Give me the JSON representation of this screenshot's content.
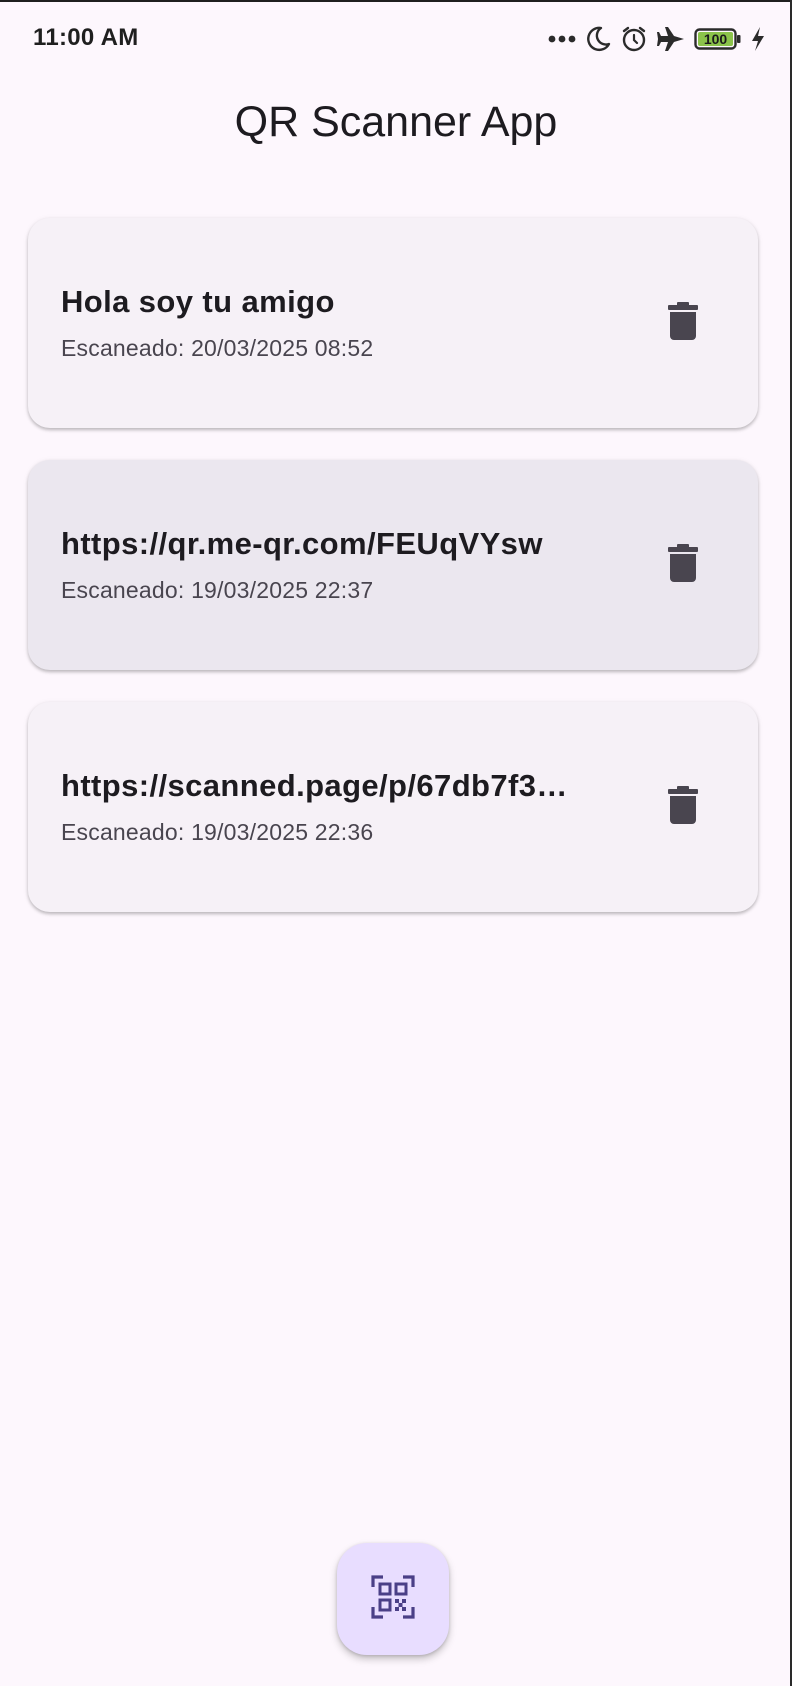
{
  "status_bar": {
    "time": "11:00 AM",
    "battery_level": "100",
    "icons": [
      "more-dots-icon",
      "moon-icon",
      "alarm-icon",
      "airplane-icon",
      "battery-icon",
      "charging-bolt-icon"
    ]
  },
  "app_bar": {
    "title": "QR Scanner App"
  },
  "scans": [
    {
      "value": "Hola soy tu amigo",
      "scanned_label": "Escaneado: 20/03/2025 08:52",
      "icon": "delete-icon"
    },
    {
      "value": "https://qr.me-qr.com/FEUqVYsw",
      "scanned_label": "Escaneado: 19/03/2025 22:37",
      "icon": "delete-icon",
      "highlighted": true
    },
    {
      "value": "https://scanned.page/p/67db7f3…",
      "scanned_label": "Escaneado: 19/03/2025 22:36",
      "icon": "delete-icon"
    }
  ],
  "fab": {
    "icon": "qr-scanner-icon"
  },
  "colors": {
    "background": "#fdf7fd",
    "card": "#f6f1f7",
    "card_highlight": "#ebe7ef",
    "fab_background": "#e8ddff",
    "fab_icon": "#4a3f87",
    "icon_dark": "#49454f",
    "battery_fill": "#8bc34a"
  }
}
